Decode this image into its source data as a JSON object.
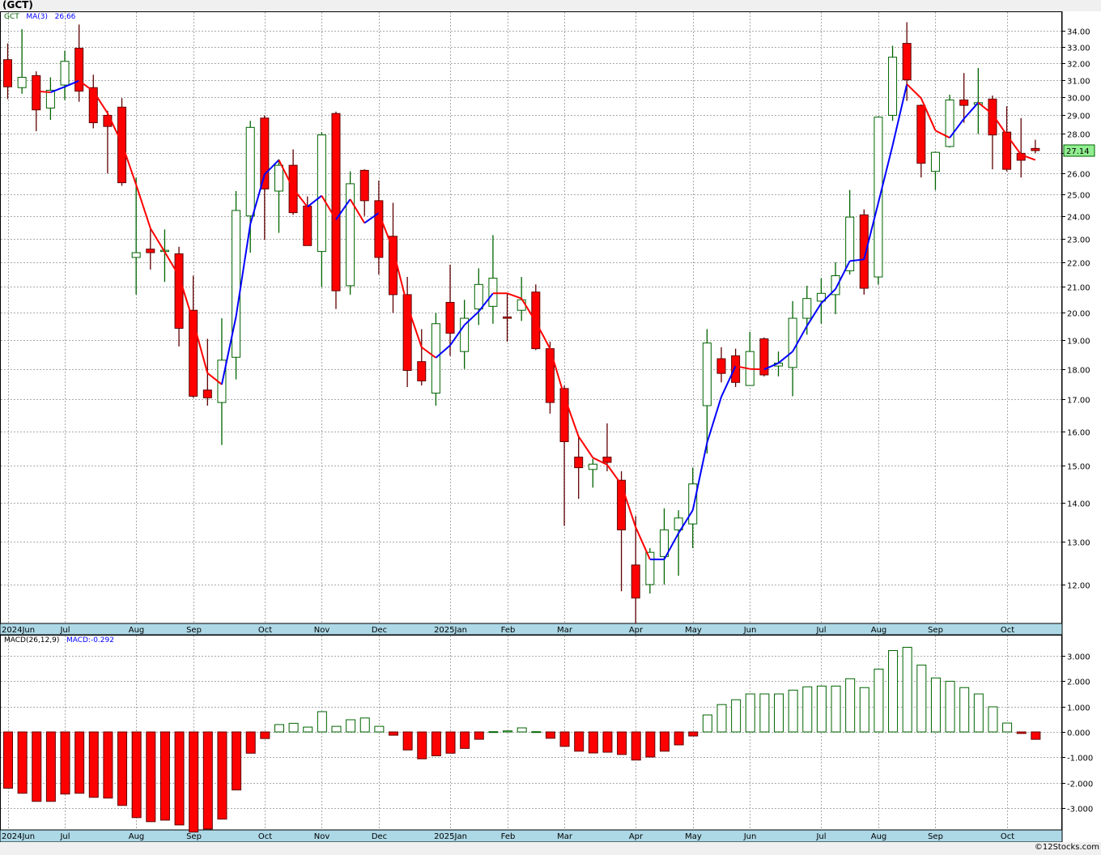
{
  "header": {
    "title": "(GCT)"
  },
  "legend": {
    "symbol": "GCT",
    "ma_label": "MA(3)",
    "ma_value": "26.66",
    "macd_label": "MACD(26,12,9)",
    "macd_value": "MACD:-0.292"
  },
  "last_price_label": "27.14",
  "footer": {
    "copyright": "©12Stocks.com"
  },
  "colors": {
    "up": "#006400",
    "down_fill": "#ff0000",
    "down_stroke": "#600000",
    "ma_up": "#0000ff",
    "ma_down": "#ff0000",
    "axis_band": "#add8e6",
    "last_price_bg": "#90ee90"
  },
  "chart_data": [
    {
      "type": "candlestick",
      "title": "",
      "y_scale": "log",
      "ylim": [
        11.1,
        35.2
      ],
      "grid": true,
      "y_ticks": [
        "34.00",
        "33.00",
        "32.00",
        "31.00",
        "30.00",
        "29.00",
        "28.00",
        "27.00",
        "26.00",
        "25.00",
        "24.00",
        "23.00",
        "22.00",
        "21.00",
        "20.00",
        "19.00",
        "18.00",
        "17.00",
        "16.00",
        "15.00",
        "14.00",
        "13.00",
        "12.00"
      ],
      "x_ticks": [
        {
          "label": "2024Jun",
          "index": 0
        },
        {
          "label": "Jul",
          "index": 4
        },
        {
          "label": "Aug",
          "index": 9
        },
        {
          "label": "Sep",
          "index": 13
        },
        {
          "label": "Oct",
          "index": 18
        },
        {
          "label": "Nov",
          "index": 22
        },
        {
          "label": "Dec",
          "index": 26
        },
        {
          "label": "2025Jan",
          "index": 31
        },
        {
          "label": "Feb",
          "index": 35
        },
        {
          "label": "Mar",
          "index": 39
        },
        {
          "label": "Apr",
          "index": 44
        },
        {
          "label": "May",
          "index": 48
        },
        {
          "label": "Jun",
          "index": 52
        },
        {
          "label": "Jul",
          "index": 57
        },
        {
          "label": "Aug",
          "index": 61
        },
        {
          "label": "Sep",
          "index": 65
        },
        {
          "label": "Oct",
          "index": 70
        }
      ],
      "ma_period": 3,
      "ohlc_fields": [
        "open",
        "high",
        "low",
        "close"
      ],
      "ohlc": [
        [
          32.2,
          33.2,
          29.9,
          30.6
        ],
        [
          30.55,
          34.1,
          30.2,
          31.15
        ],
        [
          31.25,
          31.5,
          28.15,
          29.3
        ],
        [
          29.4,
          31.15,
          28.75,
          30.4
        ],
        [
          30.7,
          32.75,
          29.85,
          32.1
        ],
        [
          32.9,
          34.4,
          29.75,
          30.35
        ],
        [
          30.55,
          31.3,
          28.3,
          28.6
        ],
        [
          29.0,
          29.25,
          26.0,
          28.4
        ],
        [
          29.45,
          29.95,
          25.4,
          25.55
        ],
        [
          22.2,
          25.8,
          20.7,
          22.4
        ],
        [
          22.55,
          23.45,
          21.7,
          22.4
        ],
        [
          22.45,
          23.4,
          21.2,
          22.5
        ],
        [
          22.35,
          22.65,
          18.78,
          19.43
        ],
        [
          20.1,
          21.45,
          17.05,
          17.1
        ],
        [
          17.3,
          19.05,
          16.8,
          17.05
        ],
        [
          16.9,
          19.8,
          15.6,
          18.3
        ],
        [
          18.4,
          25.15,
          17.65,
          24.25
        ],
        [
          24.0,
          28.7,
          22.4,
          28.35
        ],
        [
          28.85,
          29.0,
          22.95,
          25.25
        ],
        [
          25.15,
          26.7,
          23.25,
          26.4
        ],
        [
          26.4,
          27.2,
          24.05,
          24.15
        ],
        [
          24.45,
          24.9,
          22.7,
          22.7
        ],
        [
          22.45,
          28.1,
          21.0,
          27.95
        ],
        [
          29.1,
          29.2,
          20.15,
          20.85
        ],
        [
          21.05,
          26.1,
          20.7,
          25.5
        ],
        [
          26.15,
          26.2,
          24.0,
          24.7
        ],
        [
          24.7,
          25.65,
          21.5,
          22.2
        ],
        [
          23.1,
          24.6,
          20.0,
          20.7
        ],
        [
          20.7,
          21.4,
          17.4,
          17.95
        ],
        [
          18.25,
          19.4,
          17.45,
          17.6
        ],
        [
          17.2,
          20.0,
          16.8,
          19.6
        ],
        [
          20.4,
          21.9,
          18.45,
          19.25
        ],
        [
          18.6,
          20.5,
          18.0,
          19.8
        ],
        [
          20.15,
          21.75,
          19.55,
          21.1
        ],
        [
          20.25,
          23.15,
          19.6,
          21.35
        ],
        [
          19.85,
          20.75,
          18.95,
          19.8
        ],
        [
          20.1,
          21.4,
          19.7,
          20.5
        ],
        [
          20.8,
          21.1,
          18.65,
          18.7
        ],
        [
          18.7,
          18.95,
          16.55,
          16.9
        ],
        [
          17.35,
          17.45,
          13.4,
          15.7
        ],
        [
          15.25,
          15.85,
          14.1,
          14.95
        ],
        [
          14.9,
          15.2,
          14.4,
          15.05
        ],
        [
          15.25,
          16.25,
          14.85,
          15.1
        ],
        [
          14.6,
          14.85,
          11.85,
          13.3
        ],
        [
          12.45,
          13.65,
          11.15,
          11.7
        ],
        [
          12.0,
          12.85,
          11.8,
          12.75
        ],
        [
          12.65,
          13.85,
          12.0,
          13.3
        ],
        [
          13.3,
          13.8,
          12.2,
          13.6
        ],
        [
          13.45,
          14.95,
          12.85,
          14.5
        ],
        [
          16.8,
          19.4,
          15.35,
          18.9
        ],
        [
          18.35,
          18.75,
          17.55,
          17.85
        ],
        [
          18.45,
          18.7,
          17.4,
          17.55
        ],
        [
          17.45,
          19.3,
          17.45,
          18.6
        ],
        [
          19.05,
          19.1,
          17.75,
          17.8
        ],
        [
          18.1,
          18.6,
          17.75,
          18.2
        ],
        [
          18.05,
          20.45,
          17.1,
          19.8
        ],
        [
          19.8,
          21.05,
          19.2,
          20.55
        ],
        [
          20.45,
          21.35,
          19.6,
          20.75
        ],
        [
          20.7,
          22.0,
          19.95,
          21.45
        ],
        [
          21.65,
          25.2,
          21.5,
          23.95
        ],
        [
          24.05,
          24.3,
          20.7,
          20.95
        ],
        [
          21.4,
          28.95,
          21.1,
          28.9
        ],
        [
          29.0,
          33.05,
          28.7,
          32.35
        ],
        [
          33.2,
          34.55,
          29.8,
          31.0
        ],
        [
          29.55,
          29.6,
          25.8,
          26.5
        ],
        [
          26.1,
          27.1,
          25.2,
          27.05
        ],
        [
          27.35,
          30.15,
          27.3,
          29.85
        ],
        [
          29.85,
          31.4,
          28.6,
          29.55
        ],
        [
          29.6,
          31.7,
          28.0,
          29.7
        ],
        [
          29.9,
          30.1,
          26.2,
          27.95
        ],
        [
          28.1,
          29.5,
          26.1,
          26.2
        ],
        [
          27.0,
          28.85,
          25.8,
          26.65
        ],
        [
          27.25,
          27.7,
          27.0,
          27.14
        ]
      ]
    },
    {
      "type": "bar",
      "title": "",
      "ylim": [
        -3.85,
        3.75
      ],
      "grid": true,
      "y_ticks": [
        "3.000",
        "2.000",
        "1.000",
        "0.000",
        "-1.000",
        "-2.000",
        "-3.000"
      ],
      "values": [
        -2.22,
        -2.42,
        -2.74,
        -2.74,
        -2.45,
        -2.42,
        -2.58,
        -2.61,
        -2.9,
        -3.38,
        -3.54,
        -3.48,
        -3.67,
        -3.95,
        -3.83,
        -3.44,
        -2.29,
        -0.84,
        -0.26,
        0.29,
        0.34,
        0.19,
        0.8,
        0.22,
        0.48,
        0.55,
        0.22,
        -0.13,
        -0.71,
        -1.06,
        -0.94,
        -0.84,
        -0.65,
        -0.29,
        0.01,
        0.04,
        0.16,
        0.01,
        -0.25,
        -0.57,
        -0.76,
        -0.83,
        -0.8,
        -0.89,
        -1.11,
        -0.99,
        -0.76,
        -0.51,
        -0.16,
        0.67,
        1.08,
        1.27,
        1.5,
        1.5,
        1.5,
        1.65,
        1.78,
        1.81,
        1.81,
        2.1,
        1.75,
        2.48,
        3.21,
        3.34,
        2.64,
        2.13,
        2.0,
        1.75,
        1.5,
        0.99,
        0.35,
        -0.06,
        -0.292
      ]
    }
  ]
}
